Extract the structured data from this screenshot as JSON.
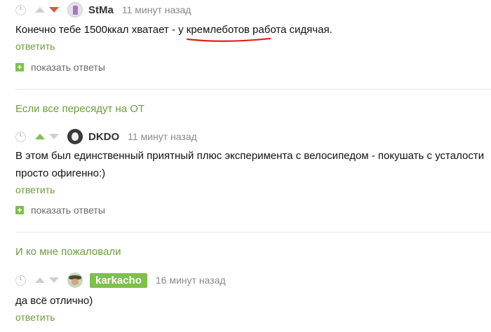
{
  "comments": [
    {
      "username": "StMa",
      "time": "11 минут назад",
      "text": "Конечно тебе 1500ккал хватает - у кремлеботов работа сидячая.",
      "reply_label": "ответить",
      "show_replies_label": "показать ответы",
      "vote": "down"
    },
    {
      "username": "DKDO",
      "time": "11 минут назад",
      "text": "В этом был единственный приятный плюс эксперимента с велосипедом - покушать с усталости просто офигенно:)",
      "reply_label": "ответить",
      "show_replies_label": "показать ответы",
      "vote": "up"
    },
    {
      "username": "karkacho",
      "time": "16 минут назад",
      "text": "да всё отлично)",
      "reply_label": "ответить"
    }
  ],
  "thread_titles": [
    "Если все пересядут на ОТ",
    "И ко мне пожаловали"
  ],
  "colors": {
    "accent_green": "#7ec04a",
    "link_green": "#6c9e3c",
    "downvote_red": "#e2543f",
    "markup_red": "#e0201a"
  }
}
